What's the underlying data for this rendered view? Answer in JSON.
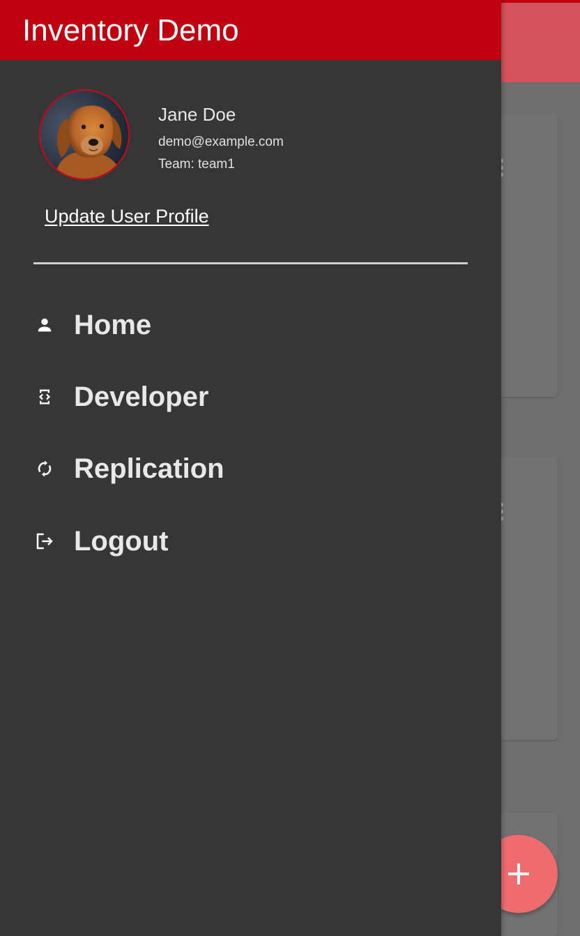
{
  "app": {
    "title": "Inventory Demo"
  },
  "user": {
    "name": "Jane Doe",
    "email": "demo@example.com",
    "team": "Team: team1",
    "avatar": "golden-retriever-photo"
  },
  "drawer": {
    "update_profile_label": "Update User Profile",
    "nav_items": [
      {
        "label": "Home",
        "icon": "person-icon"
      },
      {
        "label": "Developer",
        "icon": "developer-mode-icon"
      },
      {
        "label": "Replication",
        "icon": "sync-icon"
      },
      {
        "label": "Logout",
        "icon": "logout-icon"
      }
    ]
  },
  "fab": {
    "icon": "plus-icon"
  },
  "colors": {
    "primary": "#bf0010",
    "drawer_background": "#363636",
    "fab": "#ee6b70",
    "scrim": "#6e6e6e"
  }
}
